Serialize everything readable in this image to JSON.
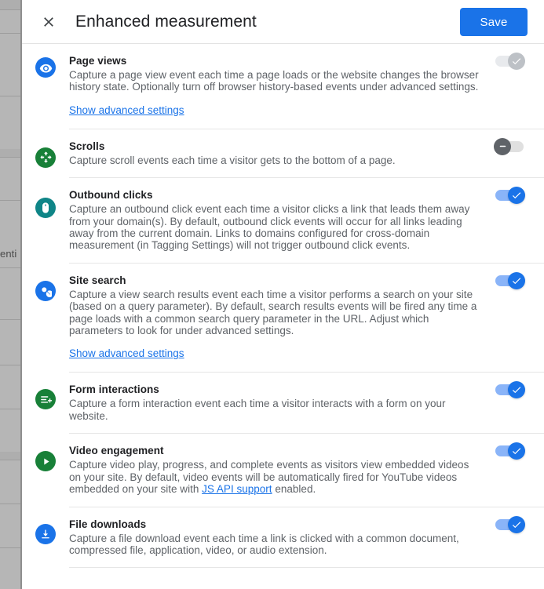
{
  "backdrop": {
    "partial_text": "enti"
  },
  "header": {
    "close_icon": "close-icon",
    "title": "Enhanced measurement",
    "save_label": "Save"
  },
  "settings": [
    {
      "id": "page-views",
      "icon": "eye-icon",
      "icon_color": "#1a73e8",
      "title": "Page views",
      "description": "Capture a page view event each time a page loads or the website changes the browser history state. Optionally turn off browser history-based events under advanced settings.",
      "advanced_link": "Show advanced settings",
      "toggle_state": "on-disabled",
      "toggle_icon": "check-icon"
    },
    {
      "id": "scrolls",
      "icon": "scroll-move-icon",
      "icon_color": "#188038",
      "title": "Scrolls",
      "description": "Capture scroll events each time a visitor gets to the bottom of a page.",
      "advanced_link": null,
      "toggle_state": "off-disabled",
      "toggle_icon": "minus-icon"
    },
    {
      "id": "outbound-clicks",
      "icon": "mouse-click-icon",
      "icon_color": "#0f8587",
      "title": "Outbound clicks",
      "description": "Capture an outbound click event each time a visitor clicks a link that leads them away from your domain(s). By default, outbound click events will occur for all links leading away from the current domain. Links to domains configured for cross-domain measurement (in Tagging Settings) will not trigger outbound click events.",
      "advanced_link": null,
      "toggle_state": "on",
      "toggle_icon": "check-icon"
    },
    {
      "id": "site-search",
      "icon": "search-icon",
      "icon_color": "#1a73e8",
      "title": "Site search",
      "description": "Capture a view search results event each time a visitor performs a search on your site (based on a query parameter). By default, search results events will be fired any time a page loads with a common search query parameter in the URL. Adjust which parameters to look for under advanced settings.",
      "advanced_link": "Show advanced settings",
      "toggle_state": "on",
      "toggle_icon": "check-icon"
    },
    {
      "id": "form-interactions",
      "icon": "form-add-icon",
      "icon_color": "#188038",
      "title": "Form interactions",
      "description": "Capture a form interaction event each time a visitor interacts with a form on your website.",
      "advanced_link": null,
      "toggle_state": "on",
      "toggle_icon": "check-icon"
    },
    {
      "id": "video-engagement",
      "icon": "play-icon",
      "icon_color": "#188038",
      "title": "Video engagement",
      "description_part1": "Capture video play, progress, and complete events as visitors view embedded videos on your site. By default, video events will be automatically fired for YouTube videos embedded on your site with ",
      "description_link": "JS API support",
      "description_part2": " enabled.",
      "advanced_link": null,
      "toggle_state": "on",
      "toggle_icon": "check-icon"
    },
    {
      "id": "file-downloads",
      "icon": "download-icon",
      "icon_color": "#1a73e8",
      "title": "File downloads",
      "description": "Capture a file download event each time a link is clicked with a common document, compressed file, application, video, or audio extension.",
      "advanced_link": null,
      "toggle_state": "on",
      "toggle_icon": "check-icon"
    }
  ],
  "colors": {
    "accent": "#1a73e8",
    "accent_light": "#8ab4f8",
    "green": "#188038",
    "teal": "#0f8587",
    "text_primary": "#202124",
    "text_secondary": "#5f6368",
    "divider": "#e6e6e6"
  }
}
